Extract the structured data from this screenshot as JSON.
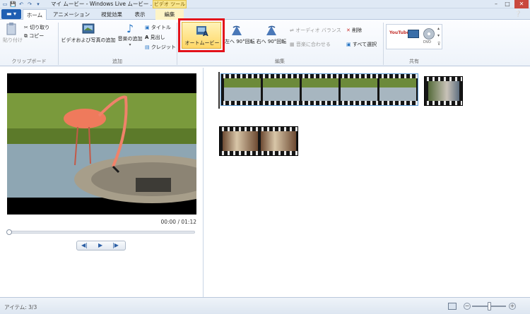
{
  "window": {
    "title": "マイ ムービー - Windows Live ムービー ...",
    "context_tab": "ビデオ ツール",
    "min": "–",
    "max": "□",
    "close": "✕"
  },
  "tabs": [
    {
      "label": "ホーム",
      "active": true
    },
    {
      "label": "アニメーション"
    },
    {
      "label": "視覚効果"
    },
    {
      "label": "表示"
    },
    {
      "label": "編集"
    }
  ],
  "ribbon": {
    "clipboard": {
      "paste": "貼り付け",
      "cut": "切り取り",
      "copy": "コピー",
      "group": "クリップボード"
    },
    "add": {
      "add_media": "ビデオおよび写真の追加",
      "add_music": "音楽の追加",
      "title": "タイトル",
      "caption": "見出し",
      "credit": "クレジット",
      "group": "追加"
    },
    "edit": {
      "automovie": "オートムービー",
      "rotate_left": "左へ 90°回転",
      "rotate_right": "右へ 90°回転",
      "audio_balance": "オーディオ バランス",
      "fit_music": "音楽に合わせる",
      "delete": "削除",
      "select_all": "すべて選択",
      "group": "編集"
    },
    "share": {
      "group": "共有",
      "youtube": "YouTube",
      "dvd": "DVD"
    }
  },
  "preview": {
    "time": "00:00 / 01:12",
    "seek": 0
  },
  "status": {
    "items": "アイテム: 3/3",
    "zoom": 0.62
  },
  "colors": {
    "accent": "#1f5fb3",
    "highlight": "#e3121b",
    "ribbon_hover": "#ffd766"
  },
  "icons": [
    "save-icon",
    "undo-icon",
    "redo-icon",
    "paste-icon",
    "cut-icon",
    "copy-icon",
    "add-media-icon",
    "music-note-icon",
    "title-icon",
    "caption-icon",
    "credit-icon",
    "automovie-icon",
    "rotate-left-icon",
    "rotate-right-icon",
    "audio-balance-icon",
    "fit-music-icon",
    "delete-icon",
    "select-all-icon",
    "youtube-icon",
    "monitor-icon",
    "dvd-icon",
    "play-icon",
    "prev-frame-icon",
    "next-frame-icon",
    "zoom-in-icon",
    "zoom-out-icon",
    "thumbnail-view-icon"
  ]
}
